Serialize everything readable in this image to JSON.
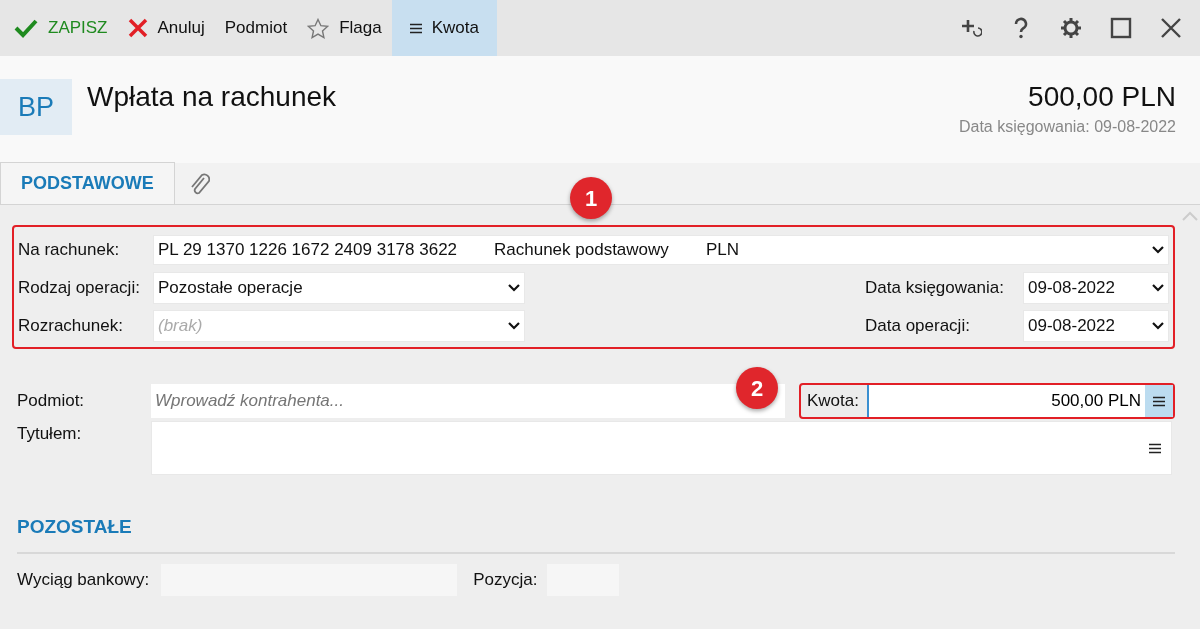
{
  "toolbar": {
    "actions": [
      {
        "kind": "check",
        "label": "ZAPISZ",
        "selected": false
      },
      {
        "kind": "cross",
        "label": "Anuluj",
        "selected": false
      },
      {
        "kind": "plain",
        "label": "Podmiot",
        "selected": false
      },
      {
        "kind": "star",
        "label": "Flaga",
        "selected": false
      },
      {
        "kind": "lines",
        "label": "Kwota",
        "selected": true
      }
    ]
  },
  "header": {
    "badge": "BP",
    "title": "Wpłata na rachunek",
    "amount": "500,00 PLN",
    "date_line": "Data księgowania: 09-08-2022"
  },
  "tabs": [
    {
      "kind": "text",
      "label": "PODSTAWOWE",
      "selected": true
    },
    {
      "kind": "attachment",
      "selected": false
    }
  ],
  "account_section": {
    "account": {
      "label": "Na rachunek:",
      "number": "PL 29 1370 1226 1672 2409 3178 3622",
      "name": "Rachunek podstawowy",
      "currency": "PLN"
    },
    "operation_type": {
      "label": "Rodzaj operacji:",
      "value": "Pozostałe operacje"
    },
    "settlement": {
      "label": "Rozrachunek:",
      "placeholder": "(brak)"
    },
    "posting_date": {
      "label": "Data księgowania:",
      "value": "09-08-2022"
    },
    "operation_date": {
      "label": "Data operacji:",
      "value": "09-08-2022"
    }
  },
  "party": {
    "label": "Podmiot:",
    "placeholder": "Wprowadź kontrahenta..."
  },
  "amount": {
    "label": "Kwota:",
    "value": "500,00 PLN"
  },
  "title_field": {
    "label": "Tytułem:"
  },
  "other_section": {
    "heading": "POZOSTAŁE",
    "statement": {
      "label": "Wyciąg bankowy:"
    },
    "position": {
      "label": "Pozycja:"
    }
  },
  "annotations": [
    {
      "number": "1"
    },
    {
      "number": "2"
    }
  ]
}
